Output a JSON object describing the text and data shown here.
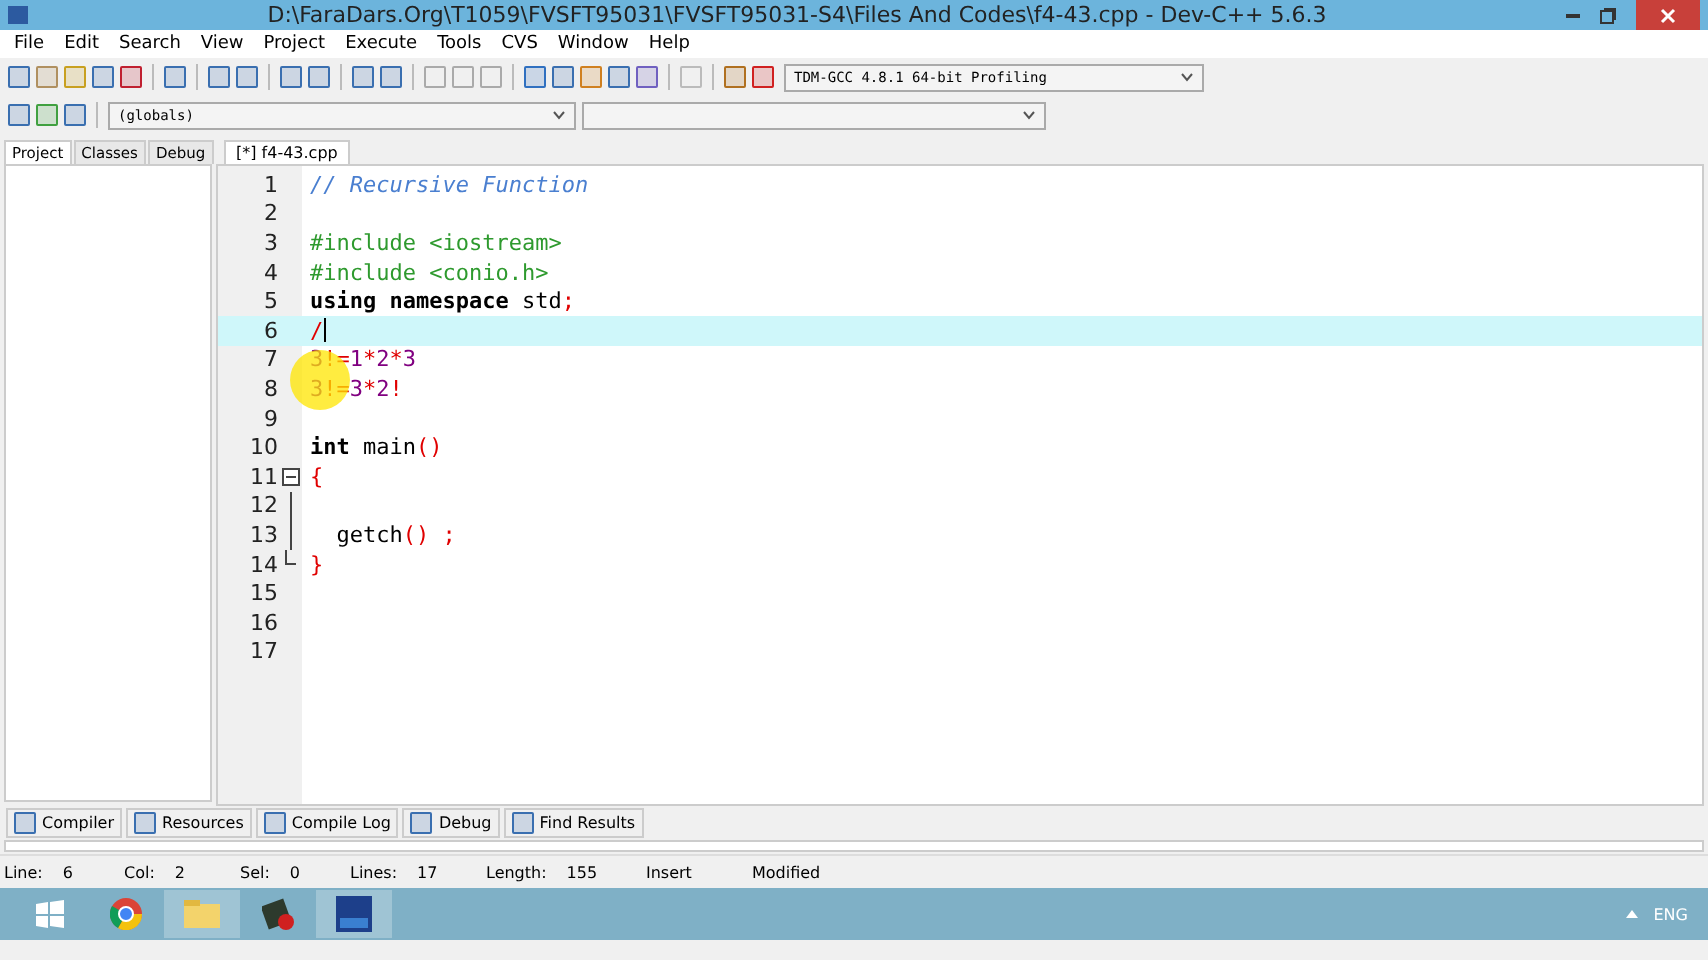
{
  "window": {
    "title": "D:\\FaraDars.Org\\T1059\\FVSFT95031\\FVSFT95031-S4\\Files And Codes\\f4-43.cpp - Dev-C++ 5.6.3"
  },
  "menu": [
    "File",
    "Edit",
    "Search",
    "View",
    "Project",
    "Execute",
    "Tools",
    "CVS",
    "Window",
    "Help"
  ],
  "compiler_select": {
    "value": "TDM-GCC 4.8.1 64-bit Profiling"
  },
  "scope_select": {
    "value": "(globals)"
  },
  "side_tabs": [
    {
      "label": "Project",
      "selected": true
    },
    {
      "label": "Classes",
      "selected": false
    },
    {
      "label": "Debug",
      "selected": false
    }
  ],
  "editor_tabs": [
    {
      "label": "[*] f4-43.cpp",
      "selected": true
    }
  ],
  "code_lines": [
    {
      "number": "1",
      "current": false,
      "kind": "plain",
      "tokens": [
        {
          "t": "// Recursive Function",
          "kind": "comment"
        }
      ]
    },
    {
      "number": "2",
      "current": false,
      "kind": "plain"
    },
    {
      "number": "3",
      "current": false,
      "kind": "plain",
      "tokens": [
        {
          "t": "#include <iostream>",
          "kind": "preproc"
        }
      ]
    },
    {
      "number": "4",
      "current": false,
      "kind": "plain",
      "tokens": [
        {
          "t": "#include <conio.h>",
          "kind": "preproc"
        }
      ]
    },
    {
      "number": "5",
      "current": false,
      "kind": "plain",
      "tokens": [
        {
          "t": "using namespace",
          "kind": "keyword"
        },
        {
          "t": " std",
          "kind": "plain"
        },
        {
          "t": ";",
          "kind": "symbol"
        }
      ]
    },
    {
      "number": "6",
      "current": true,
      "kind": "plain",
      "tokens": [
        {
          "t": "/",
          "kind": "symbol"
        }
      ]
    },
    {
      "number": "7",
      "current": false,
      "kind": "plain",
      "tokens": [
        {
          "t": "3",
          "kind": "number"
        },
        {
          "t": "!=",
          "kind": "symbol"
        },
        {
          "t": "1",
          "kind": "number"
        },
        {
          "t": "*",
          "kind": "symbol"
        },
        {
          "t": "2",
          "kind": "number"
        },
        {
          "t": "*",
          "kind": "symbol"
        },
        {
          "t": "3",
          "kind": "number"
        }
      ]
    },
    {
      "number": "8",
      "current": false,
      "kind": "plain",
      "tokens": [
        {
          "t": "3",
          "kind": "number"
        },
        {
          "t": "!=",
          "kind": "symbol"
        },
        {
          "t": "3",
          "kind": "number"
        },
        {
          "t": "*",
          "kind": "symbol"
        },
        {
          "t": "2",
          "kind": "number"
        },
        {
          "t": "!",
          "kind": "symbol"
        }
      ]
    },
    {
      "number": "9",
      "current": false,
      "kind": "plain"
    },
    {
      "number": "10",
      "current": false,
      "kind": "plain",
      "tokens": [
        {
          "t": "int",
          "kind": "keyword"
        },
        {
          "t": " main",
          "kind": "plain"
        },
        {
          "t": "()",
          "kind": "symbol"
        }
      ]
    },
    {
      "number": "11",
      "current": false,
      "kind": "fold-start",
      "tokens": [
        {
          "t": "{",
          "kind": "symbol"
        }
      ]
    },
    {
      "number": "12",
      "current": false,
      "kind": "fold-body"
    },
    {
      "number": "13",
      "current": false,
      "kind": "fold-body",
      "tokens": [
        {
          "t": "  getch",
          "kind": "plain"
        },
        {
          "t": "()",
          "kind": "symbol"
        },
        {
          "t": " ;",
          "kind": "symbol"
        }
      ]
    },
    {
      "number": "14",
      "current": false,
      "kind": "fold-end",
      "tokens": [
        {
          "t": "}",
          "kind": "symbol"
        }
      ]
    },
    {
      "number": "15",
      "current": false,
      "kind": "plain"
    },
    {
      "number": "16",
      "current": false,
      "kind": "plain"
    },
    {
      "number": "17",
      "current": false,
      "kind": "plain"
    }
  ],
  "bottom_tabs": [
    {
      "label": "Compiler",
      "selected": false
    },
    {
      "label": "Resources",
      "selected": false
    },
    {
      "label": "Compile Log",
      "selected": false
    },
    {
      "label": "Debug",
      "selected": false
    },
    {
      "label": "Find Results",
      "selected": false
    }
  ],
  "status_bar": [
    {
      "label": "Line:",
      "value": "6"
    },
    {
      "label": "Col:",
      "value": "2"
    },
    {
      "label": "Sel:",
      "value": "0"
    },
    {
      "label": "Lines:",
      "value": "17"
    },
    {
      "label": "Length:",
      "value": "155"
    },
    {
      "label": "Insert"
    },
    {
      "label": "Modified"
    }
  ],
  "taskbar": {
    "language": "ENG"
  }
}
